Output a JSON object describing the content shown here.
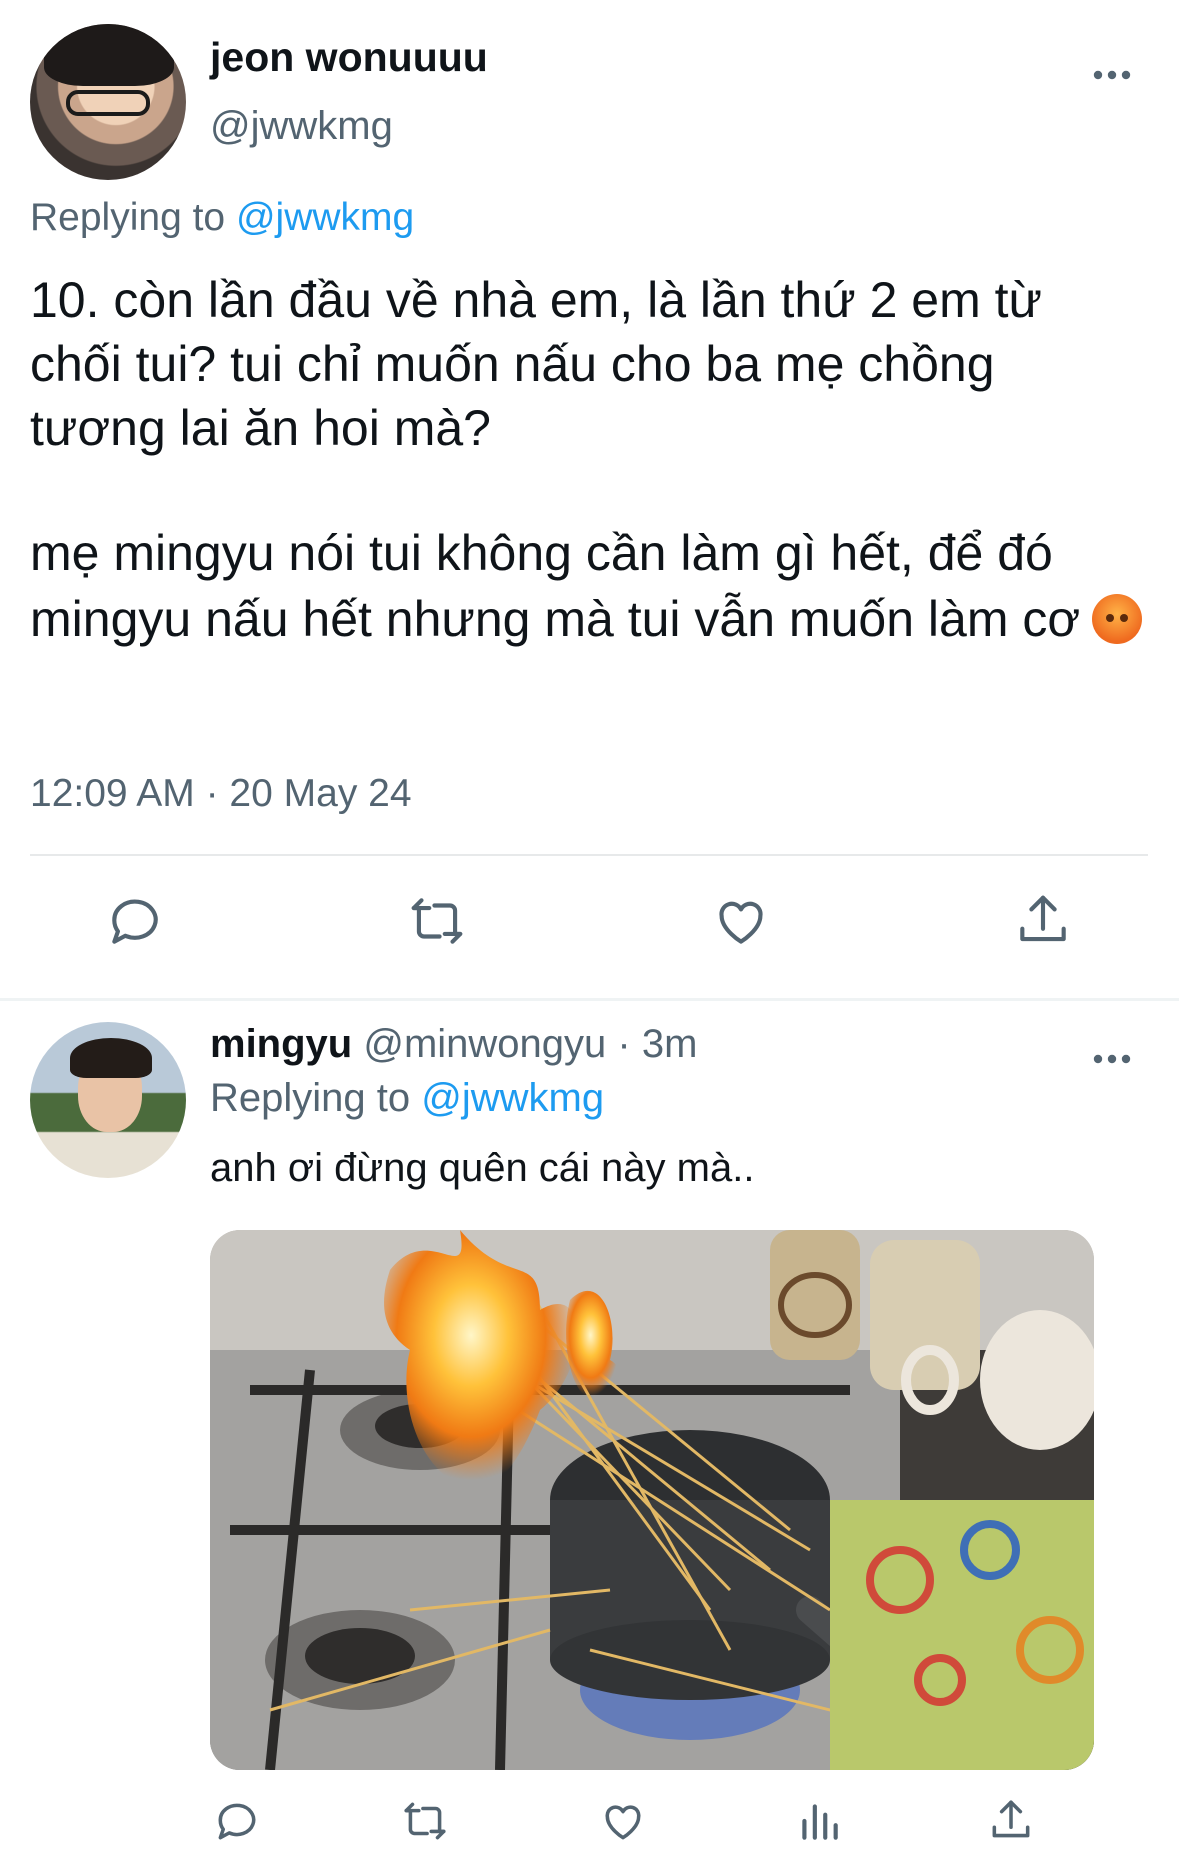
{
  "main_tweet": {
    "display_name": "jeon wonuuuu",
    "handle": "@jwwkmg",
    "replying_prefix": "Replying to",
    "replying_to": "@jwwkmg",
    "text_p1": "10. còn lần đầu về nhà em, là lần thứ 2 em từ\nchối tui? tui chỉ muốn nấu cho ba mẹ chồng\ntương lai ăn hoi mà?",
    "text_p2": "mẹ mingyu nói tui không cần làm gì hết, để đó mingyu nấu hết nhưng mà tui vẫn muốn làm cơ",
    "emoji": "angry-face",
    "timestamp": "12:09 AM · 20 May 24",
    "more_icon": "ellipsis-icon",
    "actions": [
      "reply-icon",
      "retweet-icon",
      "like-icon",
      "share-icon"
    ]
  },
  "reply_tweet": {
    "display_name": "mingyu",
    "meta": "@minwongyu · 3m",
    "replying_prefix": "Replying to",
    "replying_to": "@jwwkmg",
    "text": "anh ơi đừng quên cái này mà..",
    "media_description": "photo",
    "actions": [
      "reply-icon",
      "retweet-icon",
      "like-icon",
      "analytics-icon",
      "share-icon"
    ]
  },
  "colors": {
    "text": "#0f1419",
    "secondary": "#536471",
    "link": "#1d9bf0",
    "divider": "#e7e9ea"
  }
}
